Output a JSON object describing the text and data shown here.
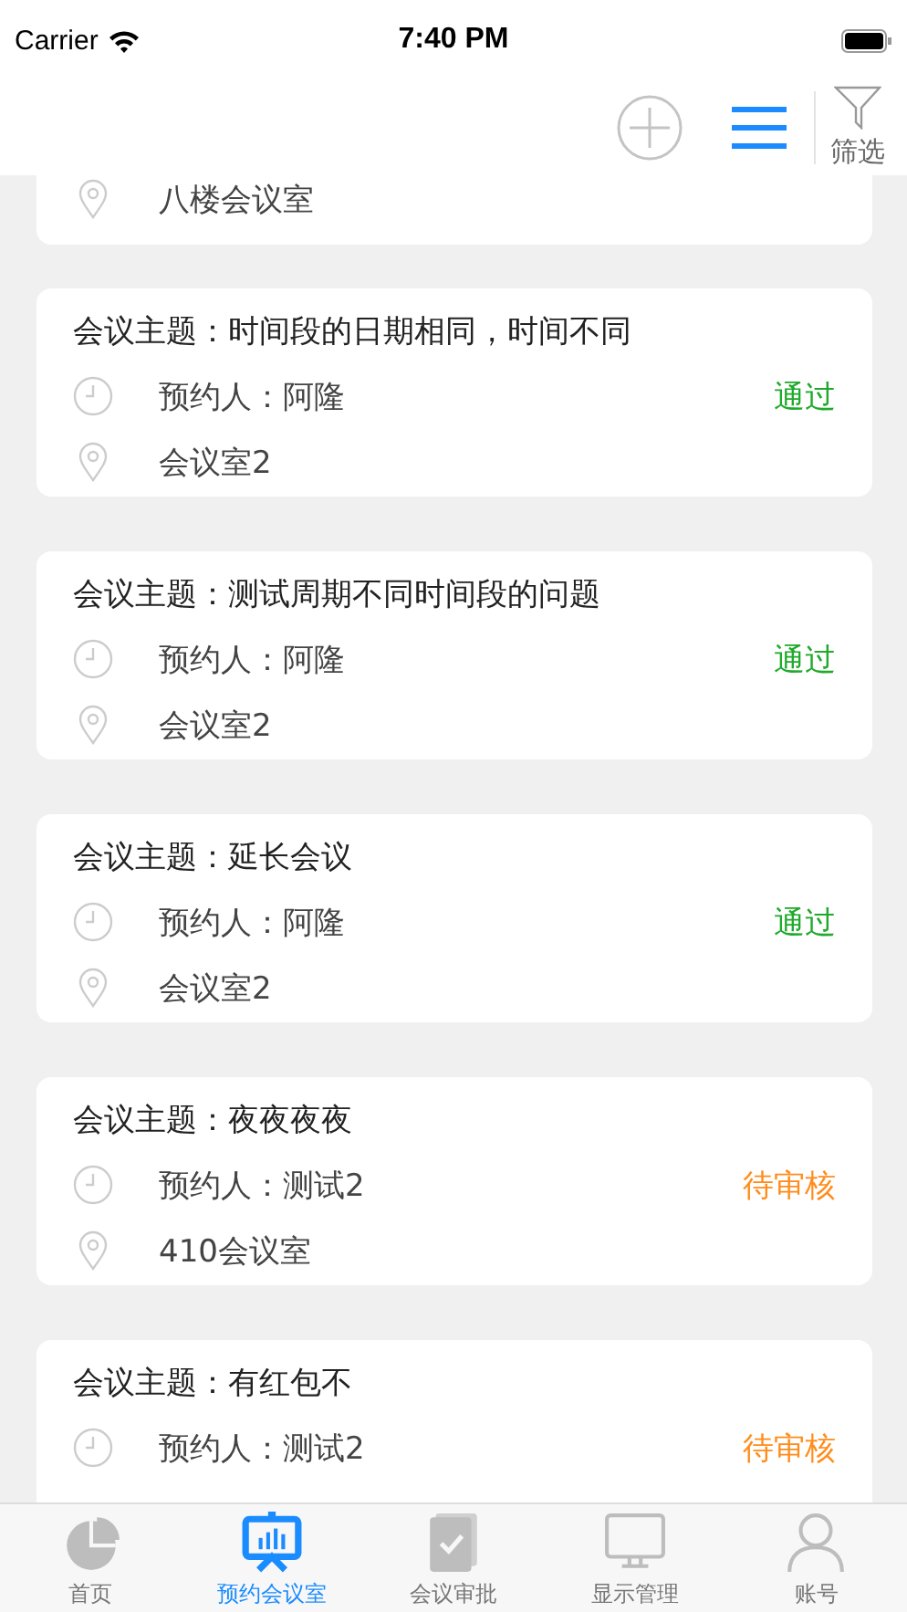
{
  "status_bar": {
    "carrier": "Carrier",
    "time": "7:40 PM"
  },
  "nav_bar": {
    "filter_label": "筛选"
  },
  "partial_card": {
    "room": "八楼会议室"
  },
  "meetings": [
    {
      "topic": "会议主题：时间段的日期相同，时间不同",
      "booker": "预约人：阿隆",
      "status": "通过",
      "kind": "approved",
      "room": "会议室2"
    },
    {
      "topic": "会议主题：测试周期不同时间段的问题",
      "booker": "预约人：阿隆",
      "status": "通过",
      "kind": "approved",
      "room": "会议室2"
    },
    {
      "topic": "会议主题：延长会议",
      "booker": "预约人：阿隆",
      "status": "通过",
      "kind": "approved",
      "room": "会议室2"
    },
    {
      "topic": "会议主题：夜夜夜夜",
      "booker": "预约人：测试2",
      "status": "待审核",
      "kind": "pending",
      "room": "410会议室"
    },
    {
      "topic": "会议主题：有红包不",
      "booker": "预约人：测试2",
      "status": "待审核",
      "kind": "pending"
    }
  ],
  "tab_bar": [
    {
      "label": "首页",
      "selected": false
    },
    {
      "label": "预约会议室",
      "selected": true
    },
    {
      "label": "会议审批",
      "selected": false
    },
    {
      "label": "显示管理",
      "selected": false
    },
    {
      "label": "账号",
      "selected": false
    }
  ]
}
